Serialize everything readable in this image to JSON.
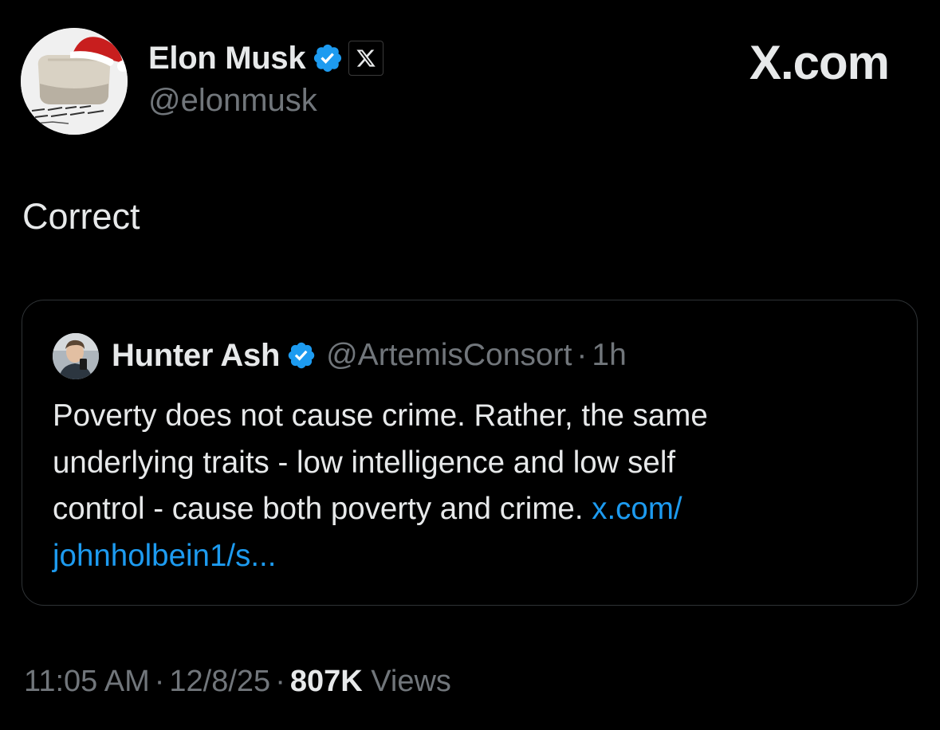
{
  "post": {
    "author_name": "Elon Musk",
    "author_handle": "@elonmusk",
    "text": "Correct",
    "time": "11:05 AM",
    "date": "12/8/25",
    "views_count": "807K",
    "views_label": "Views",
    "avatar_icon": "santa-hat-avatar",
    "verified_icon": "verified-badge-icon",
    "affiliate_icon": "x-logo-icon"
  },
  "brand": {
    "label": "X.com"
  },
  "quote": {
    "author_name": "Hunter Ash",
    "author_handle": "@ArtemisConsort",
    "separator": "·",
    "relative_time": "1h",
    "text_lines": [
      "Poverty does not cause crime. Rather, the same",
      "underlying traits - low intelligence and low self",
      "control - cause both poverty and crime."
    ],
    "link_part1": "x.com/",
    "link_part2": "johnholbein1/s..."
  },
  "colors": {
    "background": "#000000",
    "text_primary": "#e7e9ea",
    "text_secondary": "#71767b",
    "link": "#1d9bf0",
    "verified": "#1d9bf0",
    "border": "#2f3336"
  }
}
